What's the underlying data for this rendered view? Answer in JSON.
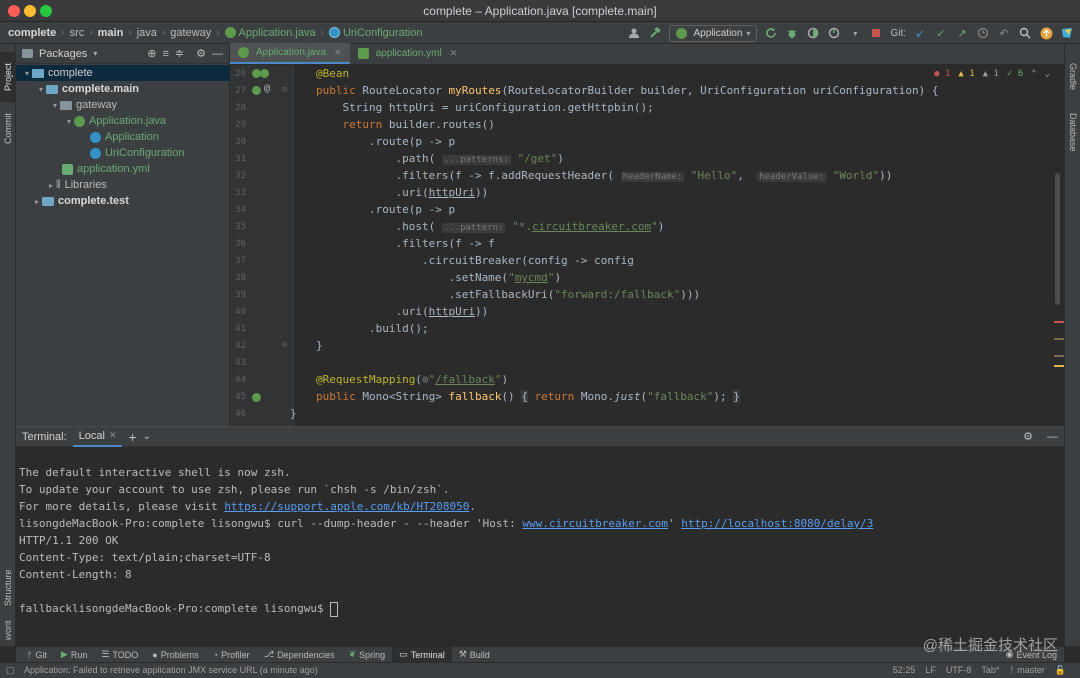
{
  "window": {
    "title": "complete – Application.java [complete.main]",
    "traffic_colors": [
      "#ff5f57",
      "#febc2e",
      "#28c840"
    ]
  },
  "breadcrumbs": [
    "complete",
    "src",
    "main",
    "java",
    "gateway",
    "Application.java",
    "UriConfiguration"
  ],
  "toolbar": {
    "run_config": "Application",
    "git_label": "Git:"
  },
  "left_stripe": [
    "Project",
    "Commit",
    "Structure",
    "Favorites"
  ],
  "right_stripe": [
    "Gradle",
    "Database"
  ],
  "project_panel": {
    "view_label": "Packages",
    "tree": [
      {
        "label": "complete",
        "level": 0,
        "arrow": "▾",
        "type": "module"
      },
      {
        "label": "complete.main",
        "level": 1,
        "arrow": "▾",
        "type": "module"
      },
      {
        "label": "gateway",
        "level": 2,
        "arrow": "▾",
        "type": "package"
      },
      {
        "label": "Application.java",
        "level": 3,
        "arrow": "▾",
        "type": "java"
      },
      {
        "label": "Application",
        "level": 4,
        "arrow": "",
        "type": "class"
      },
      {
        "label": "UriConfiguration",
        "level": 4,
        "arrow": "",
        "type": "class"
      },
      {
        "label": "application.yml",
        "level": 2,
        "arrow": "",
        "type": "yml"
      },
      {
        "label": "Libraries",
        "level": 1,
        "arrow": "▸",
        "type": "lib"
      },
      {
        "label": "complete.test",
        "level": 0,
        "arrow": "▸",
        "type": "module"
      }
    ]
  },
  "editor_tabs": [
    {
      "label": "Application.java",
      "active": true
    },
    {
      "label": "application.yml",
      "active": false
    }
  ],
  "inspections": {
    "errors": "1",
    "warnings": "1",
    "weak": "1",
    "ok": "6"
  },
  "code": {
    "line_numbers": [
      "26",
      "27",
      "28",
      "29",
      "30",
      "31",
      "32",
      "33",
      "34",
      "35",
      "36",
      "37",
      "38",
      "39",
      "40",
      "41",
      "42",
      "43",
      "44",
      "45",
      "46"
    ],
    "hints": {
      "patterns": "...patterns:",
      "header_name": "headerName:",
      "header_value": "headerValue:",
      "pattern": "...pattern:"
    },
    "strings": {
      "get": "\"/get\"",
      "hello": "\"Hello\"",
      "world": "\"World\"",
      "host_pre": "\"*.",
      "host_link": "circuitbreaker.com",
      "host_post": "\"",
      "mycmd_q1": "\"",
      "mycmd": "mycmd",
      "mycmd_q2": "\"",
      "fallback_uri": "\"forward:/fallback\"",
      "mapping_pre": "\"",
      "mapping_path": "/fallback",
      "mapping_post": "\"",
      "fallback_ret": "\"fallback\""
    }
  },
  "terminal": {
    "label": "Terminal:",
    "tab": "Local",
    "lines": {
      "l1": "The default interactive shell is now zsh.",
      "l2": "To update your account to use zsh, please run `chsh -s /bin/zsh`.",
      "l3_pre": "For more details, please visit ",
      "l3_url": "https://support.apple.com/kb/HT208050",
      "l3_post": ".",
      "l4_pre": "lisongdeMacBook-Pro:complete lisongwu$ curl --dump-header - --header 'Host: ",
      "l4_host": "www.circuitbreaker.com",
      "l4_mid": "' ",
      "l4_url": "http://localhost:8080/delay/3",
      "l5": "HTTP/1.1 200 OK",
      "l6": "Content-Type: text/plain;charset=UTF-8",
      "l7": "Content-Length: 8",
      "l8": "fallbacklisongdeMacBook-Pro:complete lisongwu$ "
    }
  },
  "tool_windows": [
    "Git",
    "Run",
    "TODO",
    "Problems",
    "Profiler",
    "Dependencies",
    "Spring",
    "Terminal",
    "Build"
  ],
  "active_tool": "Terminal",
  "event_log": "Event Log",
  "status": {
    "message": "Application: Failed to retrieve application JMX service URL (a minute ago)",
    "position": "52:25",
    "line_sep": "LF",
    "encoding": "UTF-8",
    "indent": "Tab*",
    "branch": "master"
  },
  "watermark": "@稀土掘金技术社区"
}
